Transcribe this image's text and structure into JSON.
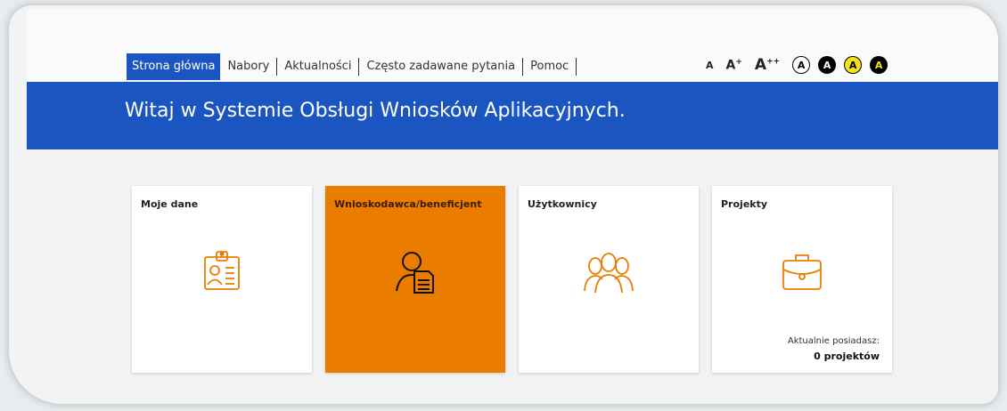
{
  "nav": {
    "items": [
      {
        "label": "Strona główna",
        "active": true
      },
      {
        "label": "Nabory"
      },
      {
        "label": "Aktualności"
      },
      {
        "label": "Często zadawane pytania"
      },
      {
        "label": "Pomoc"
      }
    ]
  },
  "accessibility": {
    "font_small": "A",
    "font_medium": "A",
    "font_medium_sup": "+",
    "font_large": "A",
    "font_large_sup": "++",
    "contrast_labels": [
      "A",
      "A",
      "A",
      "A"
    ],
    "contrast_colors": {
      "yellow": "#f7e21a",
      "black": "#000000",
      "white": "#ffffff"
    }
  },
  "banner": {
    "title": "Witaj w Systemie Obsługi Wniosków Aplikacyjnych.",
    "color": "#1a55c1"
  },
  "tiles": [
    {
      "title": "Moje dane",
      "icon": "id-badge-icon"
    },
    {
      "title": "Wnioskodawca/beneficjent",
      "icon": "applicant-document-icon",
      "active": true
    },
    {
      "title": "Użytkownicy",
      "icon": "users-group-icon"
    },
    {
      "title": "Projekty",
      "icon": "briefcase-icon",
      "note_label": "Aktualnie posiadasz:",
      "note_value": "0 projektów"
    }
  ],
  "colors": {
    "accent_orange": "#ea7d00",
    "icon_orange": "#ea7d00"
  }
}
